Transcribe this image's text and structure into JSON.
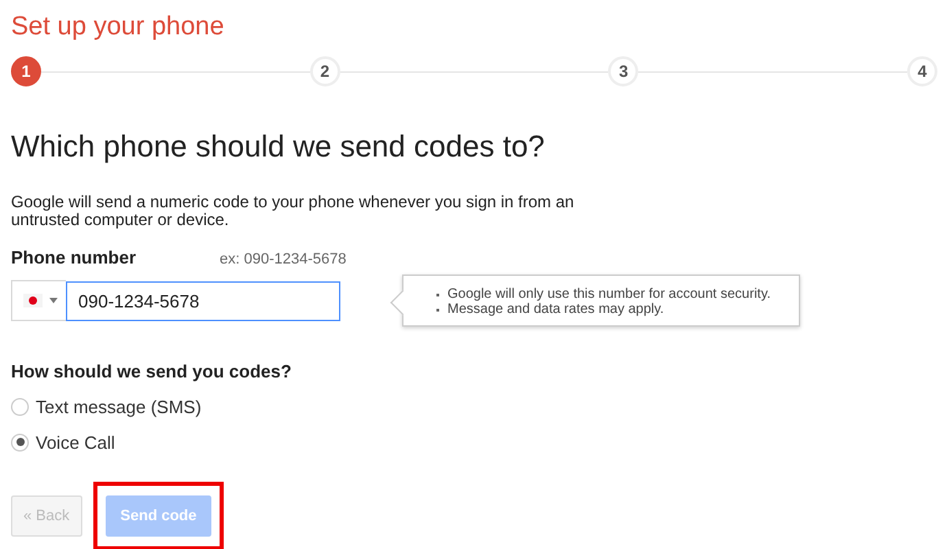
{
  "title": "Set up your phone",
  "steps": [
    {
      "label": "1",
      "selected": true
    },
    {
      "label": "2",
      "selected": false
    },
    {
      "label": "3",
      "selected": false
    },
    {
      "label": "4",
      "selected": false
    }
  ],
  "heading": "Which phone should we send codes to?",
  "description": "Google will send a numeric code to your phone whenever you sign in from an untrusted computer or device.",
  "phone": {
    "label": "Phone number",
    "example": "ex: 090-1234-5678",
    "value": "090-1234-5678",
    "focused": true
  },
  "tooltip": [
    "Google will only use this number for account security.",
    "Message and data rates may apply."
  ],
  "method_question": "How should we send you codes?",
  "methods": [
    {
      "label": "Text message (SMS)",
      "selected": false
    },
    {
      "label": "Voice Call",
      "selected": true
    }
  ],
  "buttons": [
    {
      "label": "« Back",
      "kind": "secondary",
      "disabled": true,
      "highlighted": false
    },
    {
      "label": "Send code",
      "kind": "primary",
      "disabled": true,
      "highlighted": true
    }
  ]
}
